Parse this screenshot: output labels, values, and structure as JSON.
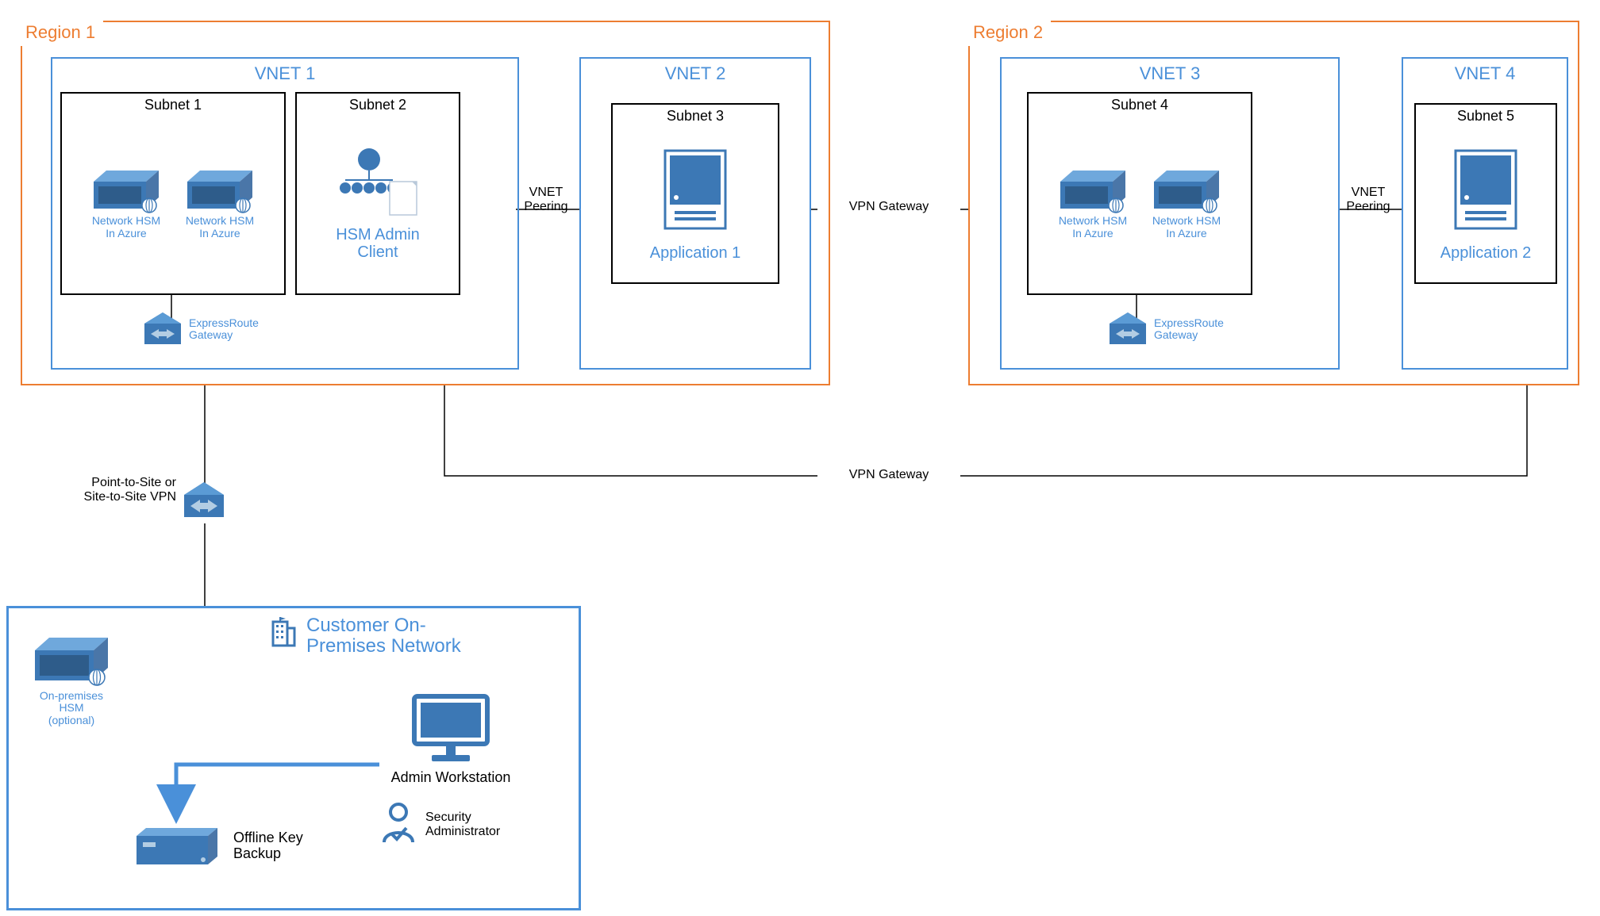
{
  "regions": {
    "r1": "Region 1",
    "r2": "Region 2"
  },
  "vnets": {
    "v1": "VNET 1",
    "v2": "VNET 2",
    "v3": "VNET 3",
    "v4": "VNET 4"
  },
  "subnets": {
    "s1": "Subnet 1",
    "s2": "Subnet 2",
    "s3": "Subnet 3",
    "s4": "Subnet 4",
    "s5": "Subnet 5"
  },
  "hsm": {
    "label": "Network HSM\nIn Azure"
  },
  "admin_client": "HSM Admin\nClient",
  "apps": {
    "a1": "Application 1",
    "a2": "Application 2"
  },
  "gateways": {
    "express_route": "ExpressRoute\nGateway",
    "vpn_p2s": "Point-to-Site or\nSite-to-Site VPN"
  },
  "links": {
    "vnet_peering": "VNET\nPeering",
    "vpn_gateway": "VPN Gateway"
  },
  "onprem": {
    "title": "Customer On-\nPremises Network",
    "hsm_label": "On-premises\nHSM\n(optional)",
    "admin_ws": "Admin Workstation",
    "sec_admin": "Security\nAdministrator",
    "offline_backup": "Offline Key\nBackup"
  }
}
